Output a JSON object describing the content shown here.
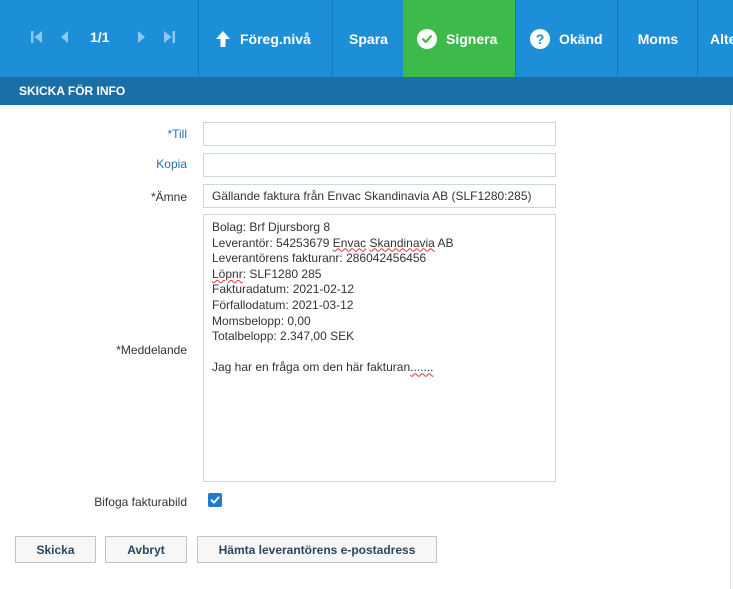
{
  "toolbar": {
    "page_count": "1/1",
    "foreg_label": "Föreg.nivå",
    "spara_label": "Spara",
    "signera_label": "Signera",
    "okand_label": "Okänd",
    "moms_label": "Moms",
    "alte_label": "Alte",
    "icons": [
      "first-page-icon",
      "prev-page-icon",
      "next-page-icon",
      "last-page-icon",
      "up-arrow-icon",
      "check-circle-icon",
      "question-circle-icon"
    ]
  },
  "header": {
    "title": "SKICKA FÖR INFO"
  },
  "form": {
    "till_label": "*Till",
    "till_value": "",
    "kopia_label": "Kopia",
    "kopia_value": "",
    "amne_label": "*Ämne",
    "amne_value": "Gällande faktura från Envac Skandinavia AB (SLF1280:285)",
    "meddelande_label": "*Meddelande",
    "meddelande_lines": {
      "l1": "Bolag: Brf Djursborg 8",
      "l2a": "Leverantör: 54253679 ",
      "l2b": "Envac",
      "l2c": " ",
      "l2d": "Skandinavia",
      "l2e": " AB",
      "l3": "Leverantörens fakturanr: 286042456456",
      "l4a": "Löpnr",
      "l4b": ": SLF1280 285",
      "l5": "Fakturadatum: 2021-02-12",
      "l6": "Förfallodatum: 2021-03-12",
      "l7": "Momsbelopp: 0,00",
      "l8": "Totalbelopp: 2.347,00 SEK",
      "l9a": "Jag har en fråga om den här fakturan",
      "l9b": "......."
    },
    "bifoga_label": "Bifoga fakturabild",
    "bifoga_checked": true
  },
  "buttons": {
    "skicka": "Skicka",
    "avbryt": "Avbryt",
    "hamta": "Hämta leverantörens e-postadress"
  },
  "colors": {
    "toolbar": "#1d8fd9",
    "header": "#1a6fa8",
    "signera": "#3dbb4a",
    "checkbox": "#1f7ad1"
  }
}
